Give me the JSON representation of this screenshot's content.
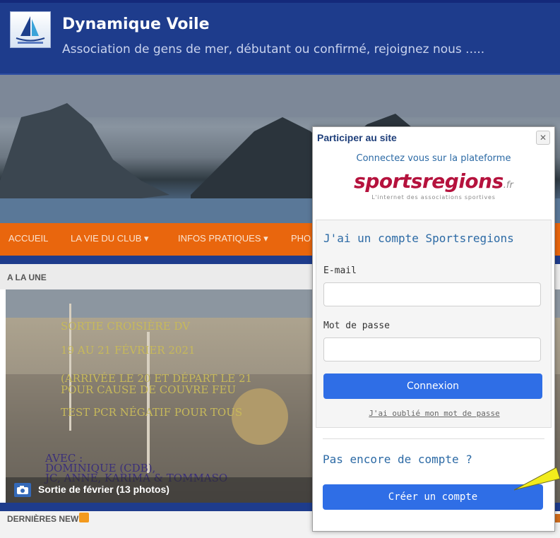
{
  "header": {
    "title": "Dynamique Voile",
    "subtitle": "Association de gens de mer, débutant ou confirmé, rejoignez nous ....."
  },
  "nav": {
    "items": [
      {
        "label": "ACCUEIL"
      },
      {
        "label": "LA VIE DU CLUB ▾"
      },
      {
        "label": "INFOS PRATIQUES ▾"
      },
      {
        "label": "PHO"
      }
    ]
  },
  "une": {
    "label": "A LA UNE",
    "overlay_lines": [
      "SORTIE CROISIÈRE DV",
      "19 AU 21 FÉVRIER 2021",
      "(ARRIVÉE LE 20 ET DÉPART LE 21",
      "POUR CAUSE DE COUVRE FEU",
      "TEST PCR NÉGATIF POUR TOUS"
    ],
    "avec_lines": [
      "AVEC :",
      "DOMINIQUE (CDB),",
      "JC, ANNE, KARIMA & TOMMASO"
    ],
    "caption": "Sortie de février (13 photos)"
  },
  "news": {
    "label": "DERNIÈRES NEWS"
  },
  "popup": {
    "title": "Participer au site",
    "close": "✕",
    "intro": "Connectez vous sur la plateforme",
    "brand_main": "sportsregions",
    "brand_tld": ".fr",
    "tagline": "L'internet des associations sportives",
    "login": {
      "heading": "J'ai un compte Sportsregions",
      "email_label": "E-mail",
      "email_value": "",
      "password_label": "Mot de passe",
      "password_value": "",
      "submit_label": "Connexion",
      "forgot_label": "J'ai oublié mon mot de passe"
    },
    "signup": {
      "heading": "Pas encore de compte ?",
      "button_label": "Créer un compte"
    }
  },
  "colors": {
    "header_blue": "#1e3c8c",
    "nav_orange": "#e9660d",
    "button_blue": "#2f6ee6",
    "brand_red": "#b5123d",
    "link_blue": "#2c6aa5"
  }
}
